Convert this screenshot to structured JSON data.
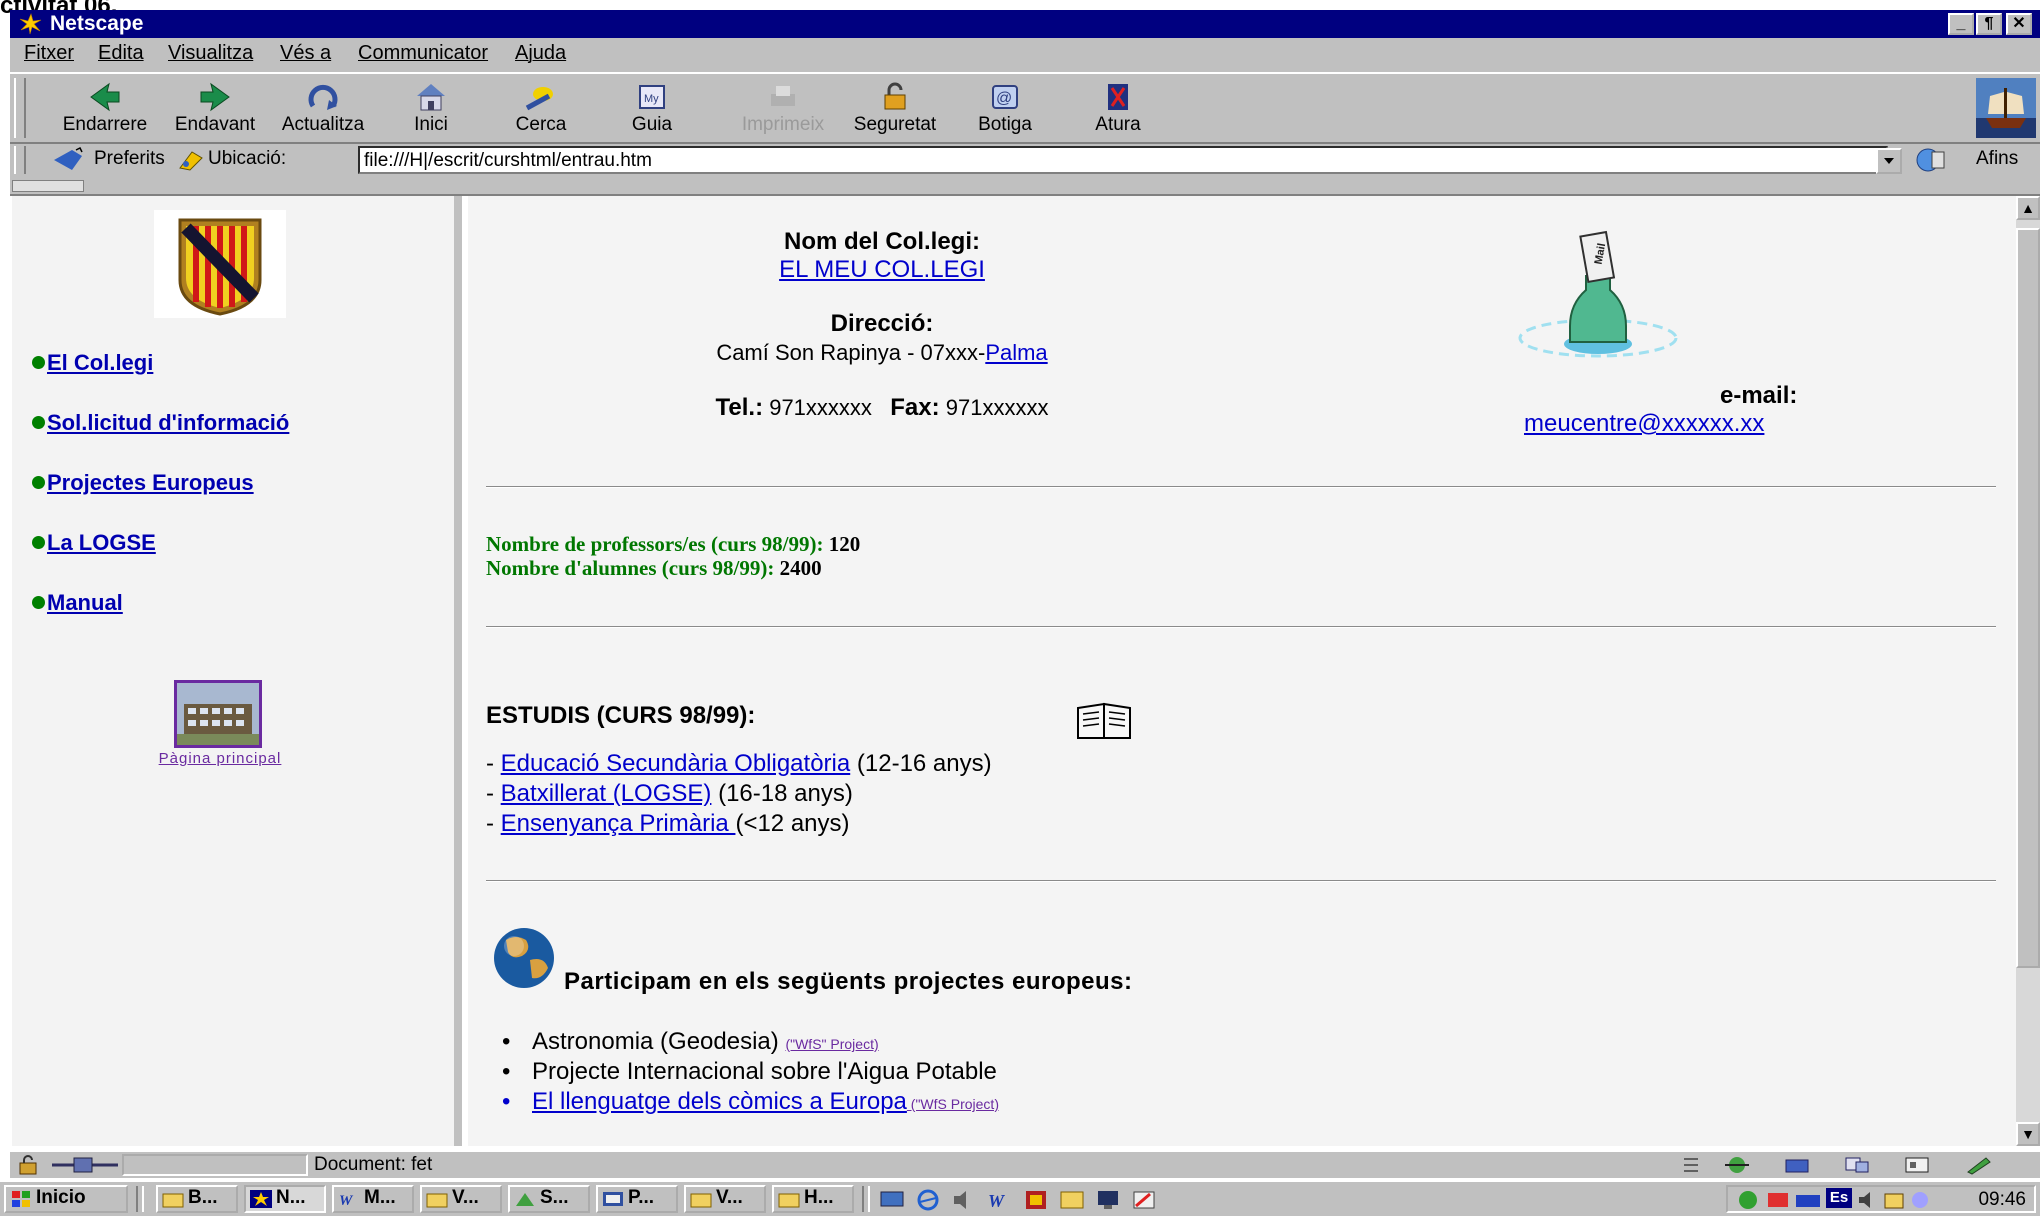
{
  "caption": "ctivitat 06.",
  "window": {
    "title": "Netscape",
    "minimize": "_",
    "maximize": "¶",
    "close": "✕"
  },
  "menu": [
    "Fitxer",
    "Edita",
    "Visualitza",
    "Vés a",
    "Communicator",
    "Ajuda"
  ],
  "toolbar": {
    "buttons": [
      {
        "label": "Endarrere",
        "icon": "back-arrow-icon"
      },
      {
        "label": "Endavant",
        "icon": "forward-arrow-icon"
      },
      {
        "label": "Actualitza",
        "icon": "reload-icon"
      },
      {
        "label": "Inici",
        "icon": "home-icon"
      },
      {
        "label": "Cerca",
        "icon": "search-icon"
      },
      {
        "label": "Guia",
        "icon": "guide-icon"
      },
      {
        "label": "Imprimeix",
        "icon": "print-icon",
        "disabled": true
      },
      {
        "label": "Seguretat",
        "icon": "lock-icon"
      },
      {
        "label": "Botiga",
        "icon": "shop-icon"
      },
      {
        "label": "Atura",
        "icon": "stop-icon"
      }
    ]
  },
  "locationbar": {
    "bookmarks_label": "Preferits",
    "location_label": "Ubicació:",
    "url": "file:///H|/escrit/curshtml/entrau.htm",
    "related_label": "Afins"
  },
  "sidebar": {
    "links": [
      "El Col.legi",
      "Sol.licitud d'informació",
      "Projectes Europeus",
      "La LOGSE",
      "Manual"
    ],
    "home_caption": "Pàgina principal"
  },
  "main": {
    "school_label": "Nom del Col.legi:",
    "school_name": "EL MEU COL.LEGI",
    "address_label": "Direcció:",
    "address_text": "Camí Son Rapinya - 07xxx-",
    "address_city": "Palma",
    "tel_label": "Tel.:",
    "tel_value": "971xxxxxx",
    "fax_label": "Fax:",
    "fax_value": "971xxxxxx",
    "email_label": "e-mail:",
    "email_value": "meucentre@xxxxxx.xx",
    "teachers_label": "Nombre de professors/es (curs 98/99):",
    "teachers_value": "120",
    "students_label": "Nombre d'alumnes (curs 98/99):",
    "students_value": "2400",
    "studies_title": "ESTUDIS (CURS 98/99):",
    "studies": [
      {
        "prefix": "- ",
        "link": "Educació Secundària Obligatòria",
        "suffix": " (12-16 anys)"
      },
      {
        "prefix": "- ",
        "link": "Batxillerat (LOGSE)",
        "suffix": " (16-18 anys)"
      },
      {
        "prefix": "- ",
        "link": "Ensenyança Primària ",
        "suffix": "(<12 anys)"
      }
    ],
    "projects_title": "Participam en els següents projectes europeus:",
    "projects": [
      {
        "text": "Astronomia (Geodesia) ",
        "link_small": "(\"WfS\" Project)"
      },
      {
        "text": "Projecte Internacional sobre l'Aigua Potable",
        "link_small": ""
      },
      {
        "link": "El llenguatge dels còmics a Europa",
        "link_small": " (\"WfS Project)"
      }
    ]
  },
  "status": {
    "text": "Document: fet"
  },
  "taskbar": {
    "start": "Inicio",
    "buttons": [
      "B...",
      "N...",
      "M...",
      "V...",
      "S...",
      "P...",
      "V...",
      "H..."
    ],
    "tray_lang": "Es",
    "clock": "09:46"
  }
}
